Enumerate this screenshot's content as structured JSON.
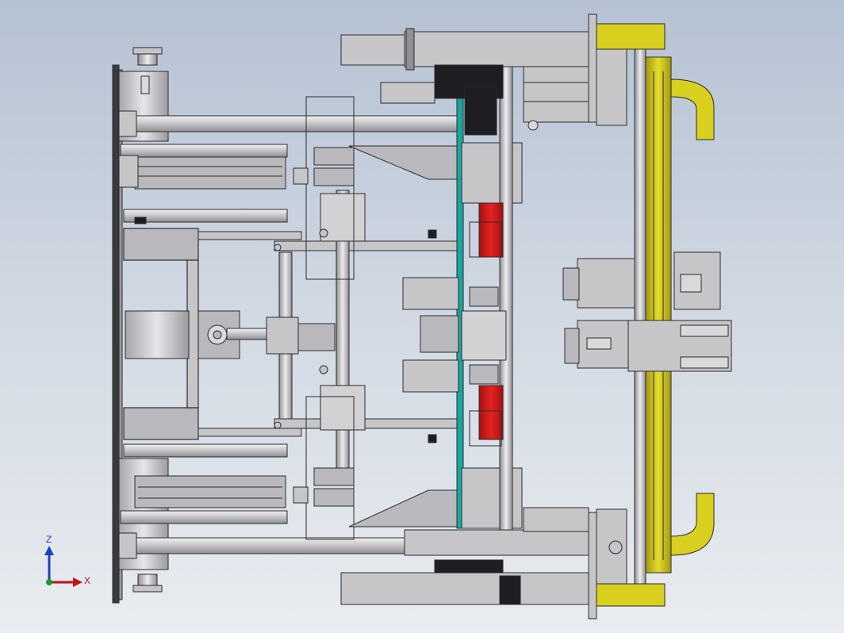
{
  "view": {
    "background_top": "#b5c2d3",
    "background_bottom": "#e9ecf0"
  },
  "colors": {
    "metal": "#c6c6c9",
    "metal_dark": "#8f9096",
    "outline": "#2b2b2e",
    "plate": "#b9b9bd",
    "yellow": "#d8cf1e",
    "yellow_dark": "#9a930d",
    "red": "#d11a1a",
    "teal": "#1aa6a0",
    "black": "#1e1e22"
  },
  "triad": {
    "z_label": "Z",
    "x_label": "X",
    "z_color": "#1f3fbf",
    "x_color": "#c0141a",
    "y_color": "#1c9a2a"
  }
}
